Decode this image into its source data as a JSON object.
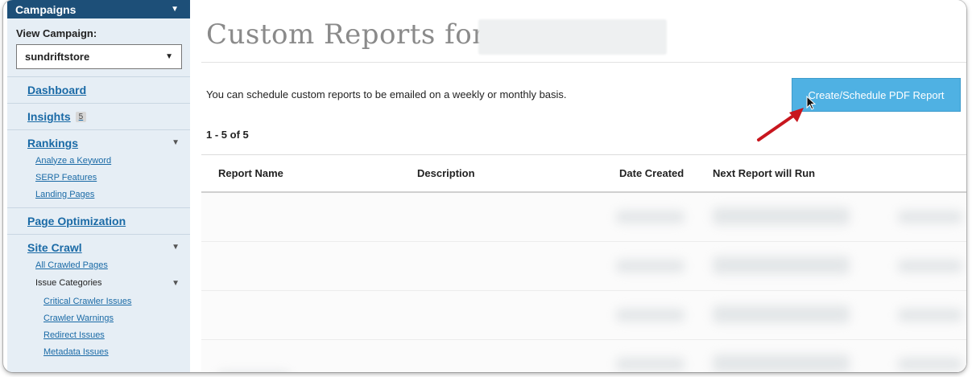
{
  "sidebar": {
    "campaigns_label": "Campaigns",
    "view_campaign_label": "View Campaign:",
    "campaign_selected": "sundriftstore",
    "items": [
      {
        "label": "Dashboard"
      },
      {
        "label": "Insights",
        "badge": "5"
      },
      {
        "label": "Rankings",
        "sub": [
          "Analyze a Keyword",
          "SERP Features",
          "Landing Pages"
        ]
      },
      {
        "label": "Page Optimization"
      },
      {
        "label": "Site Crawl",
        "sub": [
          "All Crawled Pages"
        ],
        "group_label": "Issue Categories",
        "group_items": [
          "Critical Crawler Issues",
          "Crawler Warnings",
          "Redirect Issues",
          "Metadata Issues"
        ]
      }
    ]
  },
  "main": {
    "title": "Custom Reports for",
    "info_text": "You can schedule custom reports to be emailed on a weekly or monthly basis.",
    "create_button": "Create/Schedule PDF Report",
    "count": "1 - 5 of 5",
    "columns": [
      "Report Name",
      "Description",
      "Date Created",
      "Next Report will Run"
    ]
  },
  "colors": {
    "sidebar_header": "#1d4f78",
    "link": "#1a6aa6",
    "button": "#4fb1e3",
    "arrow": "#c8161e"
  }
}
